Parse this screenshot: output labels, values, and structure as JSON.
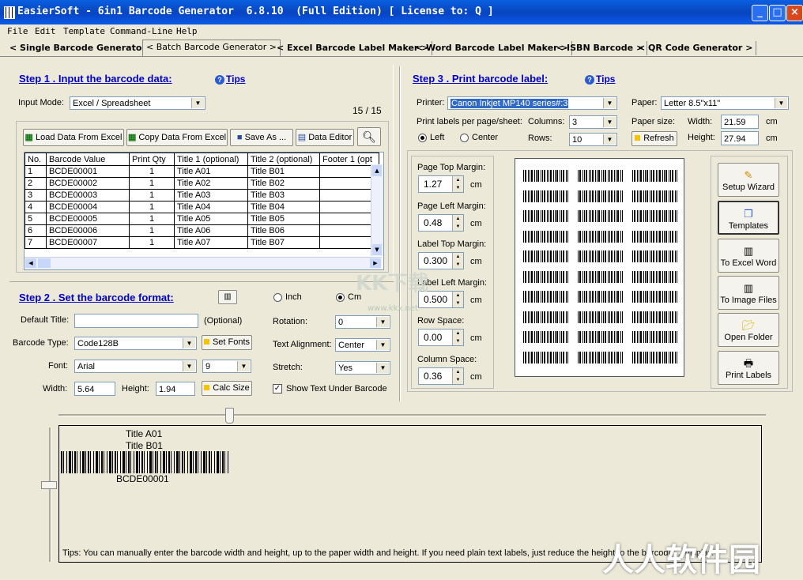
{
  "window": {
    "title": "EasierSoft - 6in1 Barcode Generator  6.8.10  (Full Edition) [ License to: Q ]",
    "min": "_",
    "max": "□",
    "close": "×"
  },
  "menu": [
    "File",
    "Edit",
    "Template",
    "Command-Line",
    "Help"
  ],
  "tabs": [
    "< Single Barcode Generator >",
    "< Batch Barcode Generator >",
    "< Excel Barcode Label Maker >",
    "< Word Barcode Label Maker >",
    "< ISBN Barcode >",
    "< QR Code Generator >"
  ],
  "step1": {
    "title": "Step 1 .  Input the barcode data:",
    "tips": "Tips",
    "input_mode_label": "Input Mode:",
    "input_mode_value": "Excel / Spreadsheet",
    "counter": "15 / 15",
    "toolbar": {
      "load": "Load Data From Excel",
      "copy": "Copy Data From Excel",
      "save": "Save As ...",
      "editor": "Data Editor"
    },
    "columns": [
      "No.",
      "Barcode Value",
      "Print Qty",
      "Title 1 (optional)",
      "Title 2 (optional)",
      "Footer 1 (opt"
    ],
    "rows": [
      [
        "1",
        "BCDE00001",
        "1",
        "Title A01",
        "Title B01",
        ""
      ],
      [
        "2",
        "BCDE00002",
        "1",
        "Title A02",
        "Title B02",
        ""
      ],
      [
        "3",
        "BCDE00003",
        "1",
        "Title A03",
        "Title B03",
        ""
      ],
      [
        "4",
        "BCDE00004",
        "1",
        "Title A04",
        "Title B04",
        ""
      ],
      [
        "5",
        "BCDE00005",
        "1",
        "Title A05",
        "Title B05",
        ""
      ],
      [
        "6",
        "BCDE00006",
        "1",
        "Title A06",
        "Title B06",
        ""
      ],
      [
        "7",
        "BCDE00007",
        "1",
        "Title A07",
        "Title B07",
        ""
      ]
    ]
  },
  "step2": {
    "title": "Step 2 . Set the barcode format:",
    "unit_inch": "Inch",
    "unit_cm": "Cm",
    "default_title_label": "Default Title:",
    "default_title_value": "",
    "optional": "(Optional)",
    "barcode_type_label": "Barcode Type:",
    "barcode_type_value": "Code128B",
    "set_fonts": "Set Fonts",
    "font_label": "Font:",
    "font_value": "Arial",
    "font_size": "9",
    "width_label": "Width:",
    "width_value": "5.64",
    "height_label": "Height:",
    "height_value": "1.94",
    "calc_size": "Calc Size",
    "rotation_label": "Rotation:",
    "rotation_value": "0",
    "text_align_label": "Text Alignment:",
    "text_align_value": "Center",
    "stretch_label": "Stretch:",
    "stretch_value": "Yes",
    "show_text": "Show Text Under Barcode"
  },
  "step3": {
    "title": "Step 3 . Print barcode label:",
    "tips": "Tips",
    "printer_label": "Printer:",
    "printer_value": "Canon Inkjet MP140 series#:3",
    "paper_label": "Paper:",
    "paper_value": "Letter 8.5\"x11\"",
    "per_page_label": "Print labels per page/sheet:",
    "columns_label": "Columns:",
    "columns_value": "3",
    "rows_label": "Rows:",
    "rows_value": "10",
    "align_left": "Left",
    "align_center": "Center",
    "paper_size_label": "Paper size:",
    "width_label": "Width:",
    "width_value": "21.59",
    "height_label": "Height:",
    "height_value": "27.94",
    "unit": "cm",
    "refresh": "Refresh",
    "margins": [
      {
        "label": "Page Top Margin:",
        "value": "1.27"
      },
      {
        "label": "Page Left Margin:",
        "value": "0.48"
      },
      {
        "label": "Label Top Margin:",
        "value": "0.300"
      },
      {
        "label": "Label Left Margin:",
        "value": "0.500"
      },
      {
        "label": "Row Space:",
        "value": "0.00"
      },
      {
        "label": "Column Space:",
        "value": "0.36"
      }
    ],
    "side_buttons": [
      "Setup Wizard",
      "Templates",
      "To Excel Word",
      "To Image Files",
      "Open Folder",
      "Print Labels"
    ]
  },
  "preview": {
    "title1": "Title A01",
    "title2": "Title B01",
    "barcode_text": "BCDE00001",
    "tips": "Tips: You can manually enter the barcode width and height, up to the paper width and height.    If you need plain text labels, just reduce the height to  the barcode ... display."
  },
  "watermarks": {
    "kk": "KK下载",
    "kk_url": "www.kkx.net",
    "cn": "人人软件园"
  }
}
